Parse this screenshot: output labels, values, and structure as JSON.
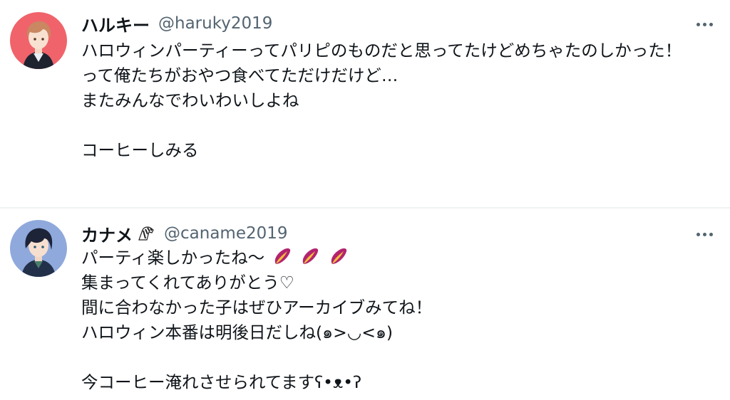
{
  "tweets": [
    {
      "display_name": "ハルキー",
      "handle": "@haruky2019",
      "more_icon": "more-horizontal-icon",
      "lines": [
        "ハロウィンパーティーってパリピのものだと思ってたけどめちゃたのしかった！",
        "って俺たちがおやつ食べてただけだけど…",
        "またみんなでわいわいしよね",
        "",
        "コーヒーしみる"
      ]
    },
    {
      "display_name": "カナメ",
      "badge_icon": "zebra-emoji-icon",
      "handle": "@caname2019",
      "more_icon": "more-horizontal-icon",
      "line1_text": "パーティ楽しかったね〜",
      "line1_emoji": "sweet-potato-emoji-icon",
      "lines": [
        "集まってくれてありがとう♡",
        "間に合わなかった子はぜひアーカイブみてね！",
        "ハロウィン本番は明後日だしね(๑>◡<๑)",
        "",
        "今コーヒー淹れさせられてますʕ•ᴥ•ʔ"
      ]
    }
  ],
  "colors": {
    "text": "#0f1419",
    "secondary": "#536471",
    "divider": "#eff3f4",
    "avatar1_bg": "#f0636a",
    "avatar2_bg": "#8fa9dc"
  }
}
